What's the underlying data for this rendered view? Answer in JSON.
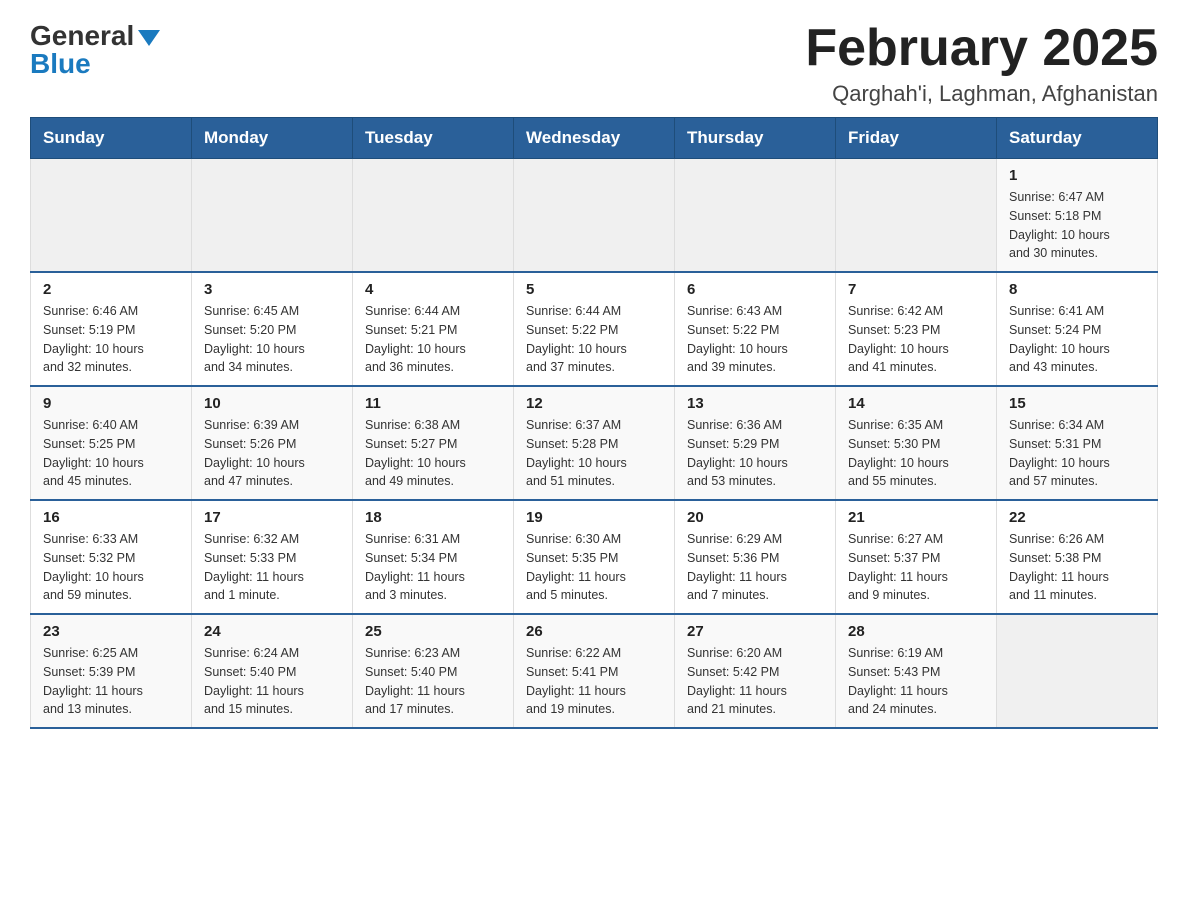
{
  "header": {
    "logo_general": "General",
    "logo_blue": "Blue",
    "title": "February 2025",
    "subtitle": "Qarghah'i, Laghman, Afghanistan"
  },
  "weekdays": [
    "Sunday",
    "Monday",
    "Tuesday",
    "Wednesday",
    "Thursday",
    "Friday",
    "Saturday"
  ],
  "weeks": [
    [
      {
        "day": "",
        "info": ""
      },
      {
        "day": "",
        "info": ""
      },
      {
        "day": "",
        "info": ""
      },
      {
        "day": "",
        "info": ""
      },
      {
        "day": "",
        "info": ""
      },
      {
        "day": "",
        "info": ""
      },
      {
        "day": "1",
        "info": "Sunrise: 6:47 AM\nSunset: 5:18 PM\nDaylight: 10 hours\nand 30 minutes."
      }
    ],
    [
      {
        "day": "2",
        "info": "Sunrise: 6:46 AM\nSunset: 5:19 PM\nDaylight: 10 hours\nand 32 minutes."
      },
      {
        "day": "3",
        "info": "Sunrise: 6:45 AM\nSunset: 5:20 PM\nDaylight: 10 hours\nand 34 minutes."
      },
      {
        "day": "4",
        "info": "Sunrise: 6:44 AM\nSunset: 5:21 PM\nDaylight: 10 hours\nand 36 minutes."
      },
      {
        "day": "5",
        "info": "Sunrise: 6:44 AM\nSunset: 5:22 PM\nDaylight: 10 hours\nand 37 minutes."
      },
      {
        "day": "6",
        "info": "Sunrise: 6:43 AM\nSunset: 5:22 PM\nDaylight: 10 hours\nand 39 minutes."
      },
      {
        "day": "7",
        "info": "Sunrise: 6:42 AM\nSunset: 5:23 PM\nDaylight: 10 hours\nand 41 minutes."
      },
      {
        "day": "8",
        "info": "Sunrise: 6:41 AM\nSunset: 5:24 PM\nDaylight: 10 hours\nand 43 minutes."
      }
    ],
    [
      {
        "day": "9",
        "info": "Sunrise: 6:40 AM\nSunset: 5:25 PM\nDaylight: 10 hours\nand 45 minutes."
      },
      {
        "day": "10",
        "info": "Sunrise: 6:39 AM\nSunset: 5:26 PM\nDaylight: 10 hours\nand 47 minutes."
      },
      {
        "day": "11",
        "info": "Sunrise: 6:38 AM\nSunset: 5:27 PM\nDaylight: 10 hours\nand 49 minutes."
      },
      {
        "day": "12",
        "info": "Sunrise: 6:37 AM\nSunset: 5:28 PM\nDaylight: 10 hours\nand 51 minutes."
      },
      {
        "day": "13",
        "info": "Sunrise: 6:36 AM\nSunset: 5:29 PM\nDaylight: 10 hours\nand 53 minutes."
      },
      {
        "day": "14",
        "info": "Sunrise: 6:35 AM\nSunset: 5:30 PM\nDaylight: 10 hours\nand 55 minutes."
      },
      {
        "day": "15",
        "info": "Sunrise: 6:34 AM\nSunset: 5:31 PM\nDaylight: 10 hours\nand 57 minutes."
      }
    ],
    [
      {
        "day": "16",
        "info": "Sunrise: 6:33 AM\nSunset: 5:32 PM\nDaylight: 10 hours\nand 59 minutes."
      },
      {
        "day": "17",
        "info": "Sunrise: 6:32 AM\nSunset: 5:33 PM\nDaylight: 11 hours\nand 1 minute."
      },
      {
        "day": "18",
        "info": "Sunrise: 6:31 AM\nSunset: 5:34 PM\nDaylight: 11 hours\nand 3 minutes."
      },
      {
        "day": "19",
        "info": "Sunrise: 6:30 AM\nSunset: 5:35 PM\nDaylight: 11 hours\nand 5 minutes."
      },
      {
        "day": "20",
        "info": "Sunrise: 6:29 AM\nSunset: 5:36 PM\nDaylight: 11 hours\nand 7 minutes."
      },
      {
        "day": "21",
        "info": "Sunrise: 6:27 AM\nSunset: 5:37 PM\nDaylight: 11 hours\nand 9 minutes."
      },
      {
        "day": "22",
        "info": "Sunrise: 6:26 AM\nSunset: 5:38 PM\nDaylight: 11 hours\nand 11 minutes."
      }
    ],
    [
      {
        "day": "23",
        "info": "Sunrise: 6:25 AM\nSunset: 5:39 PM\nDaylight: 11 hours\nand 13 minutes."
      },
      {
        "day": "24",
        "info": "Sunrise: 6:24 AM\nSunset: 5:40 PM\nDaylight: 11 hours\nand 15 minutes."
      },
      {
        "day": "25",
        "info": "Sunrise: 6:23 AM\nSunset: 5:40 PM\nDaylight: 11 hours\nand 17 minutes."
      },
      {
        "day": "26",
        "info": "Sunrise: 6:22 AM\nSunset: 5:41 PM\nDaylight: 11 hours\nand 19 minutes."
      },
      {
        "day": "27",
        "info": "Sunrise: 6:20 AM\nSunset: 5:42 PM\nDaylight: 11 hours\nand 21 minutes."
      },
      {
        "day": "28",
        "info": "Sunrise: 6:19 AM\nSunset: 5:43 PM\nDaylight: 11 hours\nand 24 minutes."
      },
      {
        "day": "",
        "info": ""
      }
    ]
  ]
}
